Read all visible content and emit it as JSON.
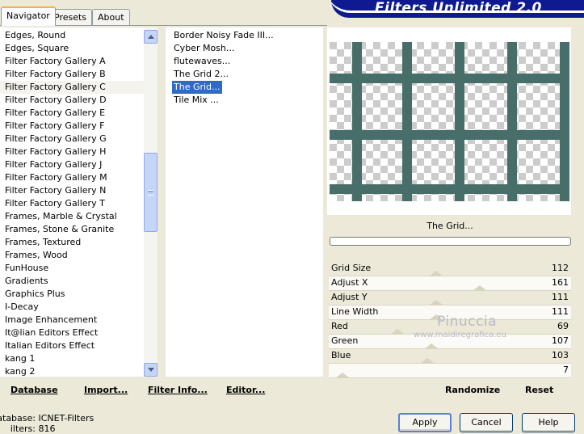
{
  "tabs": [
    {
      "label": "Navigator",
      "active": true
    },
    {
      "label": "Presets",
      "active": false
    },
    {
      "label": "About",
      "active": false
    }
  ],
  "banner": {
    "title": "Filters Unlimited 2.0"
  },
  "categories": [
    "Edges, Round",
    "Edges, Square",
    "Filter Factory Gallery A",
    "Filter Factory Gallery B",
    "Filter Factory Gallery C",
    "Filter Factory Gallery D",
    "Filter Factory Gallery E",
    "Filter Factory Gallery F",
    "Filter Factory Gallery G",
    "Filter Factory Gallery H",
    "Filter Factory Gallery J",
    "Filter Factory Gallery M",
    "Filter Factory Gallery N",
    "Filter Factory Gallery T",
    "Frames, Marble & Crystal",
    "Frames, Stone & Granite",
    "Frames, Textured",
    "Frames, Wood",
    "FunHouse",
    "Gradients",
    "Graphics Plus",
    "I-Decay",
    "Image Enhancement",
    "It@lian Editors Effect",
    "Italian Editors Effect",
    "kang 1",
    "kang 2"
  ],
  "selected_category": "Filter Factory Gallery C",
  "filters": [
    "Border Noisy Fade III...",
    "Cyber Mosh...",
    "flutewaves...",
    "The Grid 2...",
    "The Grid...",
    "Tile Mix ..."
  ],
  "selected_filter": "The Grid...",
  "preview": {
    "line_color": "#476e68",
    "checker_light": "#ffffff",
    "checker_dark": "#cccccc"
  },
  "filter_title": "The Grid...",
  "sliders": [
    {
      "label": "Grid Size",
      "value": "112",
      "level": 0.44
    },
    {
      "label": "Adjust X",
      "value": "161",
      "level": 0.63
    },
    {
      "label": "Adjust Y",
      "value": "111",
      "level": 0.44
    },
    {
      "label": "Line Width",
      "value": "111",
      "level": 0.44
    },
    {
      "label": "Red",
      "value": "69",
      "level": 0.27
    },
    {
      "label": "Green",
      "value": "107",
      "level": 0.42
    },
    {
      "label": "Blue",
      "value": "103",
      "level": 0.4
    },
    {
      "label": "",
      "value": "7",
      "level": 0.03
    }
  ],
  "watermark": {
    "name": "Pinuccia",
    "url": "www.maidiregrafica.eu"
  },
  "links": {
    "database": "Database",
    "import": "Import...",
    "filter_info": "Filter Info...",
    "editor": "Editor...",
    "randomize": "Randomize",
    "reset": "Reset"
  },
  "status": {
    "database_label": "atabase:",
    "database_value": "ICNET-Filters",
    "filters_label": "ilters:",
    "filters_value": "816"
  },
  "buttons": {
    "apply": "Apply",
    "cancel": "Cancel",
    "help": "Help"
  }
}
